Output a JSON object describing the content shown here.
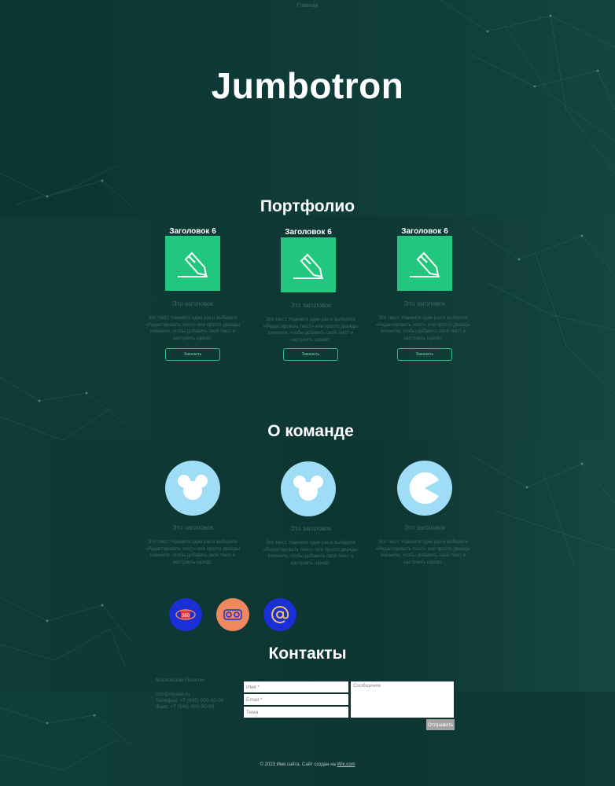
{
  "colors": {
    "accent": "#21c77f",
    "avatar_bg": "#9fdcf6",
    "background": "#0f3a36",
    "button_border": "#2bc088"
  },
  "nav": {
    "home_label": "Главная"
  },
  "hero": {
    "title": "Jumbotron"
  },
  "portfolio": {
    "title": "Портфолио",
    "cards": [
      {
        "heading": "Заголовок 6",
        "icon": "pencil-icon",
        "subtitle": "Это заголовок",
        "text": "Это текст. Нажмите один раз и выберите «Редактировать текст» или просто дважды кликните, чтобы добавить свой текст и настроить шрифт.",
        "button": "Заказать"
      },
      {
        "heading": "Заголовок 6",
        "icon": "pencil-icon",
        "subtitle": "Это заголовок",
        "text": "Это текст. Нажмите один раз и выберите «Редактировать текст» или просто дважды кликните, чтобы добавить свой текст и настроить шрифт.",
        "button": "Заказать"
      },
      {
        "heading": "Заголовок 6",
        "icon": "pencil-icon",
        "subtitle": "Это заголовок",
        "text": "Это текст. Нажмите один раз и выберите «Редактировать текст» или просто дважды кликните, чтобы добавить свой текст и настроить шрифт.",
        "button": "Заказать"
      }
    ]
  },
  "team": {
    "title": "О команде",
    "members": [
      {
        "avatar": "mouse-ears-icon",
        "subtitle": "Это заголовок",
        "text": "Это текст. Нажмите один раз и выберите «Редактировать текст» или просто дважды кликните, чтобы добавить свой текст и настроить шрифт."
      },
      {
        "avatar": "mouse-ears-icon",
        "subtitle": "Это заголовок",
        "text": "Это текст. Нажмите один раз и выберите «Редактировать текст» или просто дважды кликните, чтобы добавить свой текст и настроить шрифт."
      },
      {
        "avatar": "pacman-icon",
        "subtitle": "Это заголовок",
        "text": "Это текст. Нажмите один раз и выберите «Редактировать текст» или просто дважды кликните, чтобы добавить свой текст и настроить шрифт."
      }
    ]
  },
  "social": [
    {
      "icon": "360-view-icon",
      "color": "#1a2fd6"
    },
    {
      "icon": "vr-headset-icon",
      "color": "#f0885e"
    },
    {
      "icon": "at-sign-icon",
      "color": "#1a2fd6"
    }
  ],
  "contacts": {
    "title": "Контакты",
    "address": "Московский Политех",
    "email": "info@mysite.ru",
    "phone": "Телефон: +7 (945) 000-00-00",
    "fax": "Факс: +7 (945) 000-00-00",
    "form": {
      "name_placeholder": "Имя *",
      "email_placeholder": "Email *",
      "subject_placeholder": "Тема",
      "message_placeholder": "Сообщение",
      "submit_label": "Отправить"
    }
  },
  "footer": {
    "text": "© 2023 Имя сайта. Сайт создан на",
    "link": "Wix.com"
  }
}
